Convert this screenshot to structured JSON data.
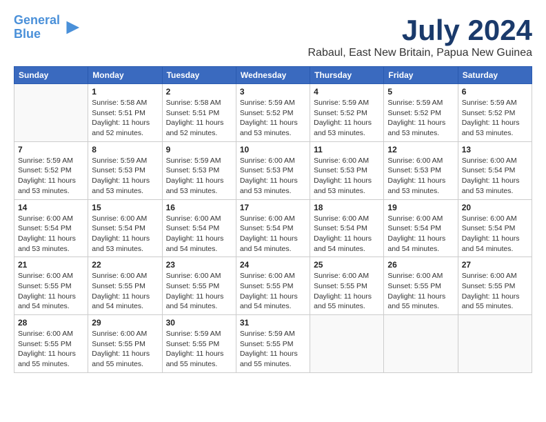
{
  "logo": {
    "line1": "General",
    "line2": "Blue",
    "icon": "▶"
  },
  "title": "July 2024",
  "location": "Rabaul, East New Britain, Papua New Guinea",
  "days_of_week": [
    "Sunday",
    "Monday",
    "Tuesday",
    "Wednesday",
    "Thursday",
    "Friday",
    "Saturday"
  ],
  "weeks": [
    [
      {
        "num": "",
        "sunrise": "",
        "sunset": "",
        "daylight": ""
      },
      {
        "num": "1",
        "sunrise": "5:58 AM",
        "sunset": "5:51 PM",
        "daylight": "11 hours and 52 minutes."
      },
      {
        "num": "2",
        "sunrise": "5:58 AM",
        "sunset": "5:51 PM",
        "daylight": "11 hours and 52 minutes."
      },
      {
        "num": "3",
        "sunrise": "5:59 AM",
        "sunset": "5:52 PM",
        "daylight": "11 hours and 53 minutes."
      },
      {
        "num": "4",
        "sunrise": "5:59 AM",
        "sunset": "5:52 PM",
        "daylight": "11 hours and 53 minutes."
      },
      {
        "num": "5",
        "sunrise": "5:59 AM",
        "sunset": "5:52 PM",
        "daylight": "11 hours and 53 minutes."
      },
      {
        "num": "6",
        "sunrise": "5:59 AM",
        "sunset": "5:52 PM",
        "daylight": "11 hours and 53 minutes."
      }
    ],
    [
      {
        "num": "7",
        "sunrise": "5:59 AM",
        "sunset": "5:52 PM",
        "daylight": "11 hours and 53 minutes."
      },
      {
        "num": "8",
        "sunrise": "5:59 AM",
        "sunset": "5:53 PM",
        "daylight": "11 hours and 53 minutes."
      },
      {
        "num": "9",
        "sunrise": "5:59 AM",
        "sunset": "5:53 PM",
        "daylight": "11 hours and 53 minutes."
      },
      {
        "num": "10",
        "sunrise": "6:00 AM",
        "sunset": "5:53 PM",
        "daylight": "11 hours and 53 minutes."
      },
      {
        "num": "11",
        "sunrise": "6:00 AM",
        "sunset": "5:53 PM",
        "daylight": "11 hours and 53 minutes."
      },
      {
        "num": "12",
        "sunrise": "6:00 AM",
        "sunset": "5:53 PM",
        "daylight": "11 hours and 53 minutes."
      },
      {
        "num": "13",
        "sunrise": "6:00 AM",
        "sunset": "5:54 PM",
        "daylight": "11 hours and 53 minutes."
      }
    ],
    [
      {
        "num": "14",
        "sunrise": "6:00 AM",
        "sunset": "5:54 PM",
        "daylight": "11 hours and 53 minutes."
      },
      {
        "num": "15",
        "sunrise": "6:00 AM",
        "sunset": "5:54 PM",
        "daylight": "11 hours and 53 minutes."
      },
      {
        "num": "16",
        "sunrise": "6:00 AM",
        "sunset": "5:54 PM",
        "daylight": "11 hours and 54 minutes."
      },
      {
        "num": "17",
        "sunrise": "6:00 AM",
        "sunset": "5:54 PM",
        "daylight": "11 hours and 54 minutes."
      },
      {
        "num": "18",
        "sunrise": "6:00 AM",
        "sunset": "5:54 PM",
        "daylight": "11 hours and 54 minutes."
      },
      {
        "num": "19",
        "sunrise": "6:00 AM",
        "sunset": "5:54 PM",
        "daylight": "11 hours and 54 minutes."
      },
      {
        "num": "20",
        "sunrise": "6:00 AM",
        "sunset": "5:54 PM",
        "daylight": "11 hours and 54 minutes."
      }
    ],
    [
      {
        "num": "21",
        "sunrise": "6:00 AM",
        "sunset": "5:55 PM",
        "daylight": "11 hours and 54 minutes."
      },
      {
        "num": "22",
        "sunrise": "6:00 AM",
        "sunset": "5:55 PM",
        "daylight": "11 hours and 54 minutes."
      },
      {
        "num": "23",
        "sunrise": "6:00 AM",
        "sunset": "5:55 PM",
        "daylight": "11 hours and 54 minutes."
      },
      {
        "num": "24",
        "sunrise": "6:00 AM",
        "sunset": "5:55 PM",
        "daylight": "11 hours and 54 minutes."
      },
      {
        "num": "25",
        "sunrise": "6:00 AM",
        "sunset": "5:55 PM",
        "daylight": "11 hours and 55 minutes."
      },
      {
        "num": "26",
        "sunrise": "6:00 AM",
        "sunset": "5:55 PM",
        "daylight": "11 hours and 55 minutes."
      },
      {
        "num": "27",
        "sunrise": "6:00 AM",
        "sunset": "5:55 PM",
        "daylight": "11 hours and 55 minutes."
      }
    ],
    [
      {
        "num": "28",
        "sunrise": "6:00 AM",
        "sunset": "5:55 PM",
        "daylight": "11 hours and 55 minutes."
      },
      {
        "num": "29",
        "sunrise": "6:00 AM",
        "sunset": "5:55 PM",
        "daylight": "11 hours and 55 minutes."
      },
      {
        "num": "30",
        "sunrise": "5:59 AM",
        "sunset": "5:55 PM",
        "daylight": "11 hours and 55 minutes."
      },
      {
        "num": "31",
        "sunrise": "5:59 AM",
        "sunset": "5:55 PM",
        "daylight": "11 hours and 55 minutes."
      },
      {
        "num": "",
        "sunrise": "",
        "sunset": "",
        "daylight": ""
      },
      {
        "num": "",
        "sunrise": "",
        "sunset": "",
        "daylight": ""
      },
      {
        "num": "",
        "sunrise": "",
        "sunset": "",
        "daylight": ""
      }
    ]
  ],
  "labels": {
    "sunrise": "Sunrise:",
    "sunset": "Sunset:",
    "daylight": "Daylight:"
  }
}
